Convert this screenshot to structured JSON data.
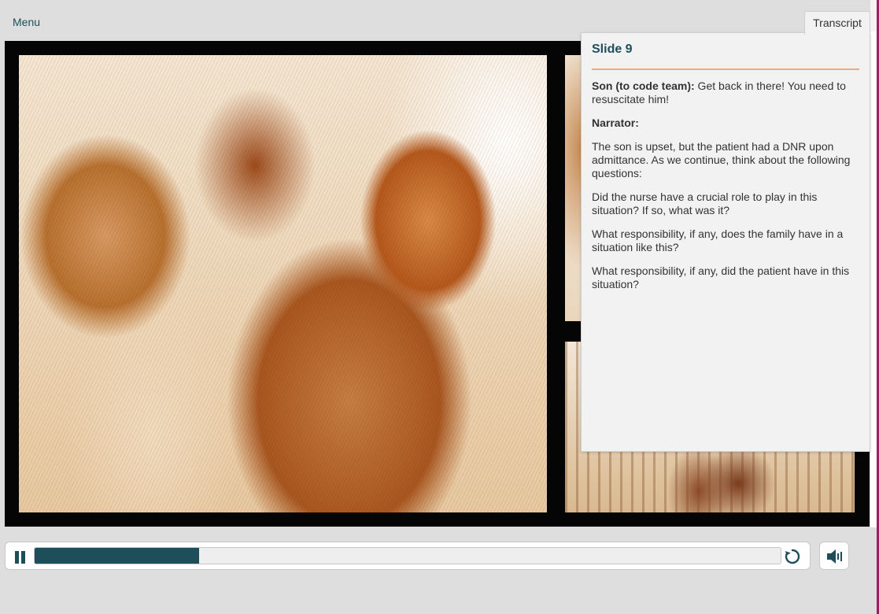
{
  "nav": {
    "menu_label": "Menu",
    "transcript_tab_label": "Transcript"
  },
  "transcript": {
    "slide_title": "Slide 9",
    "paragraphs": [
      {
        "speaker": "Son (to code team):",
        "text": " Get back in there! You need to resuscitate him!"
      },
      {
        "speaker": "Narrator:",
        "text": ""
      },
      {
        "speaker": "",
        "text": "The son is upset, but the patient had a DNR upon admittance. As we continue, think about the following questions:"
      },
      {
        "speaker": "",
        "text": "Did the nurse have a crucial role to play in this situation? If so, what was it?"
      },
      {
        "speaker": "",
        "text": "What responsibility, if any, does the family have in a situation like this?"
      },
      {
        "speaker": "",
        "text": "What responsibility, if any, did the patient have in this situation?"
      }
    ]
  },
  "player": {
    "progress": 0.22,
    "state": "playing"
  },
  "icons": {
    "pause": "pause-icon",
    "replay": "replay-icon",
    "volume": "volume-icon"
  },
  "colors": {
    "accent": "#1f4e5b",
    "divider": "#f0a883",
    "brand_edge": "#a31c5e"
  }
}
